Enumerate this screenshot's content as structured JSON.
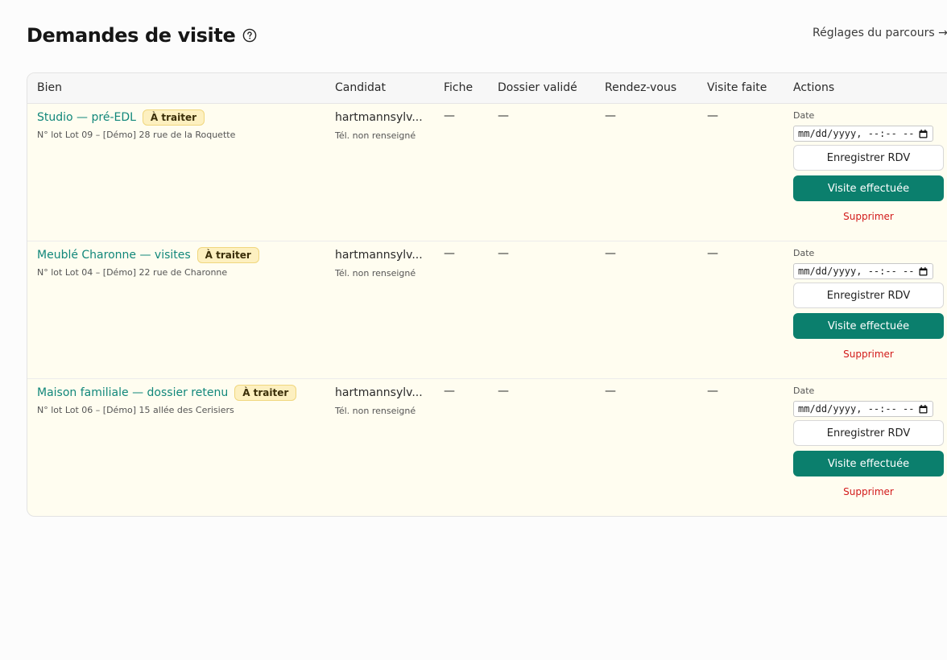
{
  "header": {
    "title": "Demandes de visite",
    "help_icon": "help-circle-icon",
    "settings_link": "Réglages du parcours →"
  },
  "table": {
    "columns": [
      "Bien",
      "Candidat",
      "Fiche",
      "Dossier validé",
      "Rendez-vous",
      "Visite faite",
      "Actions"
    ],
    "rows": [
      {
        "property_title": "Studio — pré-EDL",
        "status_badge": "À traiter",
        "property_subtitle": "N° lot Lot 09 – [Démo] 28 rue de la Roquette",
        "candidate_name": "hartmannsylv...",
        "candidate_phone": "Tél. non renseigné",
        "fiche": "—",
        "dossier_valide": "—",
        "rendez_vous": "—",
        "visite_faite": "—",
        "date_label": "Date",
        "date_placeholder": "mm/dd/yyyy, --:-- --",
        "save_label": "Enregistrer RDV",
        "done_label": "Visite effectuée",
        "delete_label": "Supprimer"
      },
      {
        "property_title": "Meublé Charonne — visites",
        "status_badge": "À traiter",
        "property_subtitle": "N° lot Lot 04 – [Démo] 22 rue de Charonne",
        "candidate_name": "hartmannsylv...",
        "candidate_phone": "Tél. non renseigné",
        "fiche": "—",
        "dossier_valide": "—",
        "rendez_vous": "—",
        "visite_faite": "—",
        "date_label": "Date",
        "date_placeholder": "mm/dd/yyyy, --:-- --",
        "save_label": "Enregistrer RDV",
        "done_label": "Visite effectuée",
        "delete_label": "Supprimer"
      },
      {
        "property_title": "Maison familiale — dossier retenu",
        "status_badge": "À traiter",
        "property_subtitle": "N° lot Lot 06 – [Démo] 15 allée des Cerisiers",
        "candidate_name": "hartmannsylv...",
        "candidate_phone": "Tél. non renseigné",
        "fiche": "—",
        "dossier_valide": "—",
        "rendez_vous": "—",
        "visite_faite": "—",
        "date_label": "Date",
        "date_placeholder": "mm/dd/yyyy, --:-- --",
        "save_label": "Enregistrer RDV",
        "done_label": "Visite effectuée",
        "delete_label": "Supprimer"
      }
    ]
  },
  "colors": {
    "accent": "#0b7f6d",
    "link": "#11877a",
    "danger": "#d21a1a",
    "badge_bg": "#fdf0c0",
    "row_bg": "#fffdf0"
  }
}
